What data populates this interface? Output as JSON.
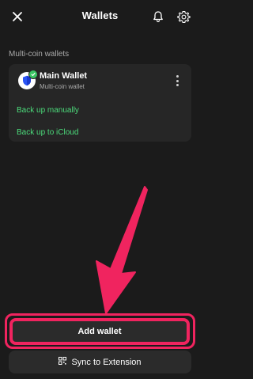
{
  "header": {
    "title": "Wallets",
    "close_icon": "close-icon",
    "bell_icon": "bell-icon",
    "gear_icon": "gear-icon"
  },
  "section": {
    "label": "Multi-coin wallets"
  },
  "wallet": {
    "name": "Main Wallet",
    "subtitle": "Multi-coin wallet",
    "avatar_icon": "shield-icon",
    "verified_icon": "check-badge-icon",
    "menu_icon": "more-vertical-icon"
  },
  "links": {
    "backup_manual": "Back up manually",
    "backup_icloud": "Back up to iCloud"
  },
  "buttons": {
    "add_wallet": "Add wallet",
    "sync_extension": "Sync to Extension",
    "sync_icon": "qr-code-icon"
  },
  "colors": {
    "background": "#1b1b1b",
    "card": "#262626",
    "accent_green": "#4cdb7b",
    "highlight": "#f0245f"
  }
}
